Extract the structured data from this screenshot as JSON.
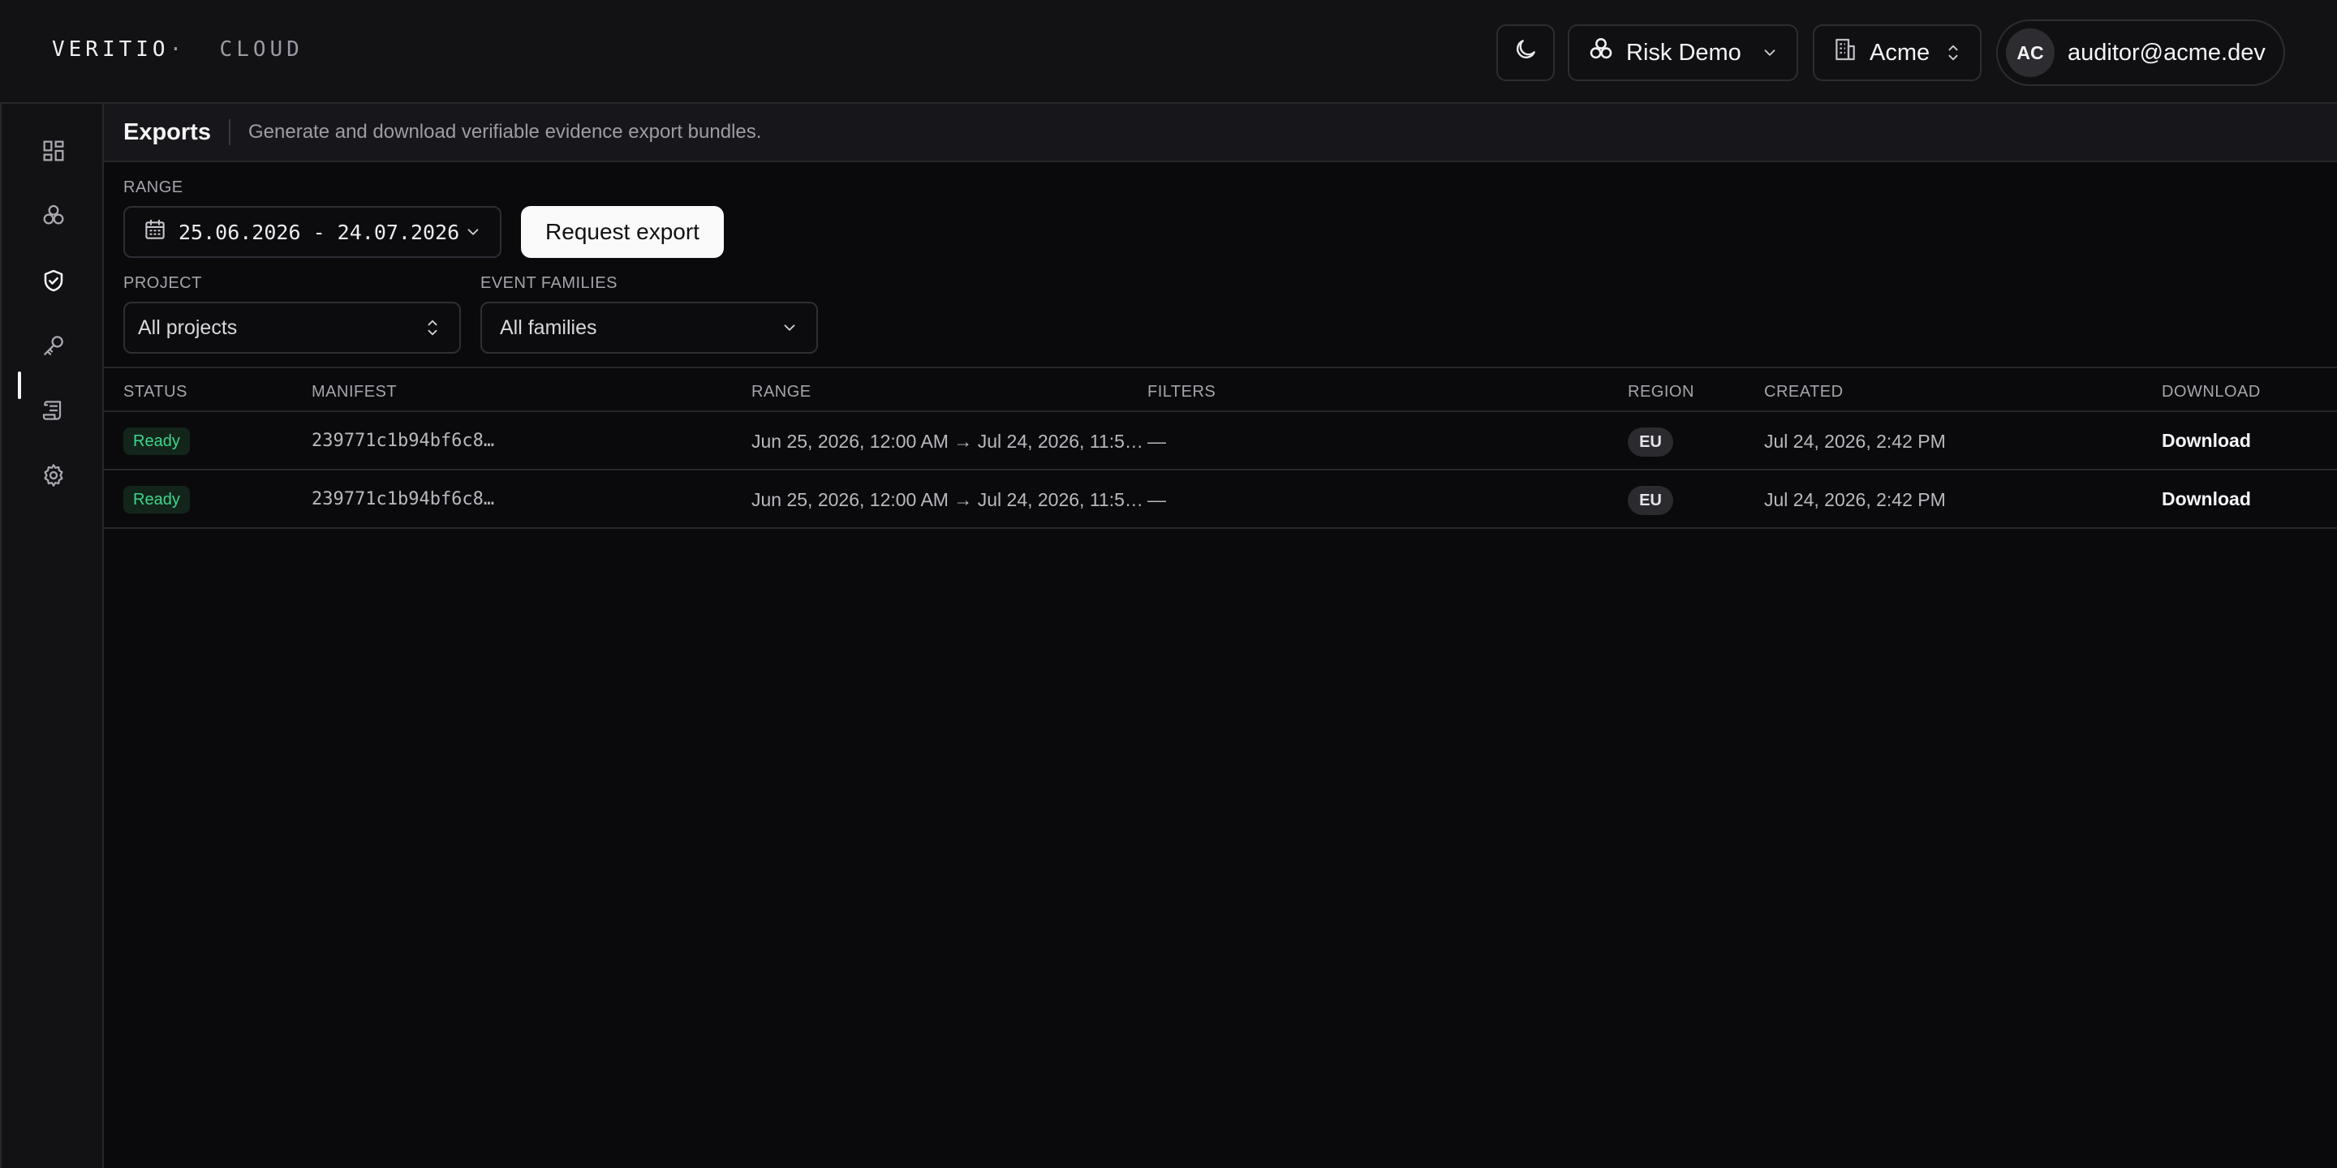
{
  "brand": {
    "name": "VERITIO",
    "dot": "·",
    "sub": "CLOUD"
  },
  "topbar": {
    "project": "Risk Demo",
    "org": "Acme",
    "user": {
      "initials": "AC",
      "email": "auditor@acme.dev"
    }
  },
  "sidebar": {
    "items": [
      {
        "name": "dashboard",
        "icon": "grid-icon"
      },
      {
        "name": "projects",
        "icon": "cluster-icon"
      },
      {
        "name": "exports",
        "icon": "shield-check-icon",
        "active": true
      },
      {
        "name": "keys",
        "icon": "key-icon"
      },
      {
        "name": "logs",
        "icon": "scroll-icon"
      },
      {
        "name": "settings",
        "icon": "gear-icon"
      }
    ]
  },
  "page": {
    "title": "Exports",
    "description": "Generate and download verifiable evidence export bundles."
  },
  "filters": {
    "range_label": "RANGE",
    "range_value": "25.06.2026 - 24.07.2026",
    "request_button": "Request export",
    "project_label": "PROJECT",
    "project_value": "All projects",
    "families_label": "EVENT FAMILIES",
    "families_value": "All families"
  },
  "table": {
    "columns": [
      "STATUS",
      "MANIFEST",
      "RANGE",
      "FILTERS",
      "REGION",
      "CREATED",
      "DOWNLOAD"
    ],
    "rows": [
      {
        "status": "Ready",
        "manifest": "239771c1b94bf6c8…",
        "range": "Jun 25, 2026, 12:00 AM → Jul 24, 2026, 11:5…",
        "filters": "—",
        "region": "EU",
        "created": "Jul 24, 2026, 2:42 PM",
        "download": "Download"
      },
      {
        "status": "Ready",
        "manifest": "239771c1b94bf6c8…",
        "range": "Jun 25, 2026, 12:00 AM → Jul 24, 2026, 11:5…",
        "filters": "—",
        "region": "EU",
        "created": "Jul 24, 2026, 2:42 PM",
        "download": "Download"
      }
    ]
  },
  "colors": {
    "accent_ready": "#3dd68c",
    "background": "#0a0a0c",
    "surface": "#121215"
  }
}
